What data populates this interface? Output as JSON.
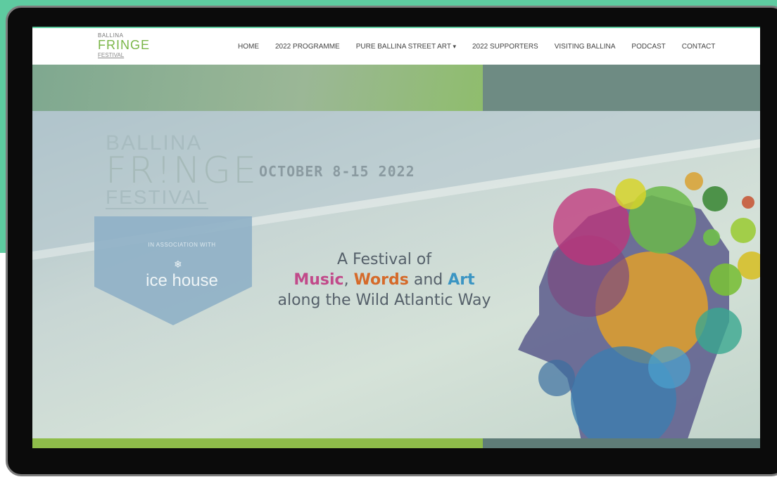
{
  "logo": {
    "line1": "BALLINA",
    "line2": "FRINGE",
    "line3": "FESTIVAL"
  },
  "nav": {
    "items": [
      {
        "label": "HOME"
      },
      {
        "label": "2022 PROGRAMME"
      },
      {
        "label": "PURE BALLINA STREET ART"
      },
      {
        "label": "2022 SUPPORTERS"
      },
      {
        "label": "VISITING BALLINA"
      },
      {
        "label": "PODCAST"
      },
      {
        "label": "CONTACT"
      }
    ]
  },
  "hero": {
    "brand_line1": "BALLINA",
    "brand_line2": "FR!NGE",
    "brand_line3": "FESTIVAL",
    "dates": "OCTOBER 8-15 2022",
    "association": "IN ASSOCIATION WITH",
    "partner": "ice house",
    "tagline1": "A Festival of",
    "music": "Music",
    "comma": ",",
    "words": "Words",
    "and": "and",
    "art": "Art",
    "tagline3": "along the Wild Atlantic Way"
  },
  "colors": {
    "page_bg": "#5ecba0",
    "accent_green": "#7ab648",
    "music": "#c14a8a",
    "words": "#d56a2a",
    "art": "#3b95c3"
  }
}
